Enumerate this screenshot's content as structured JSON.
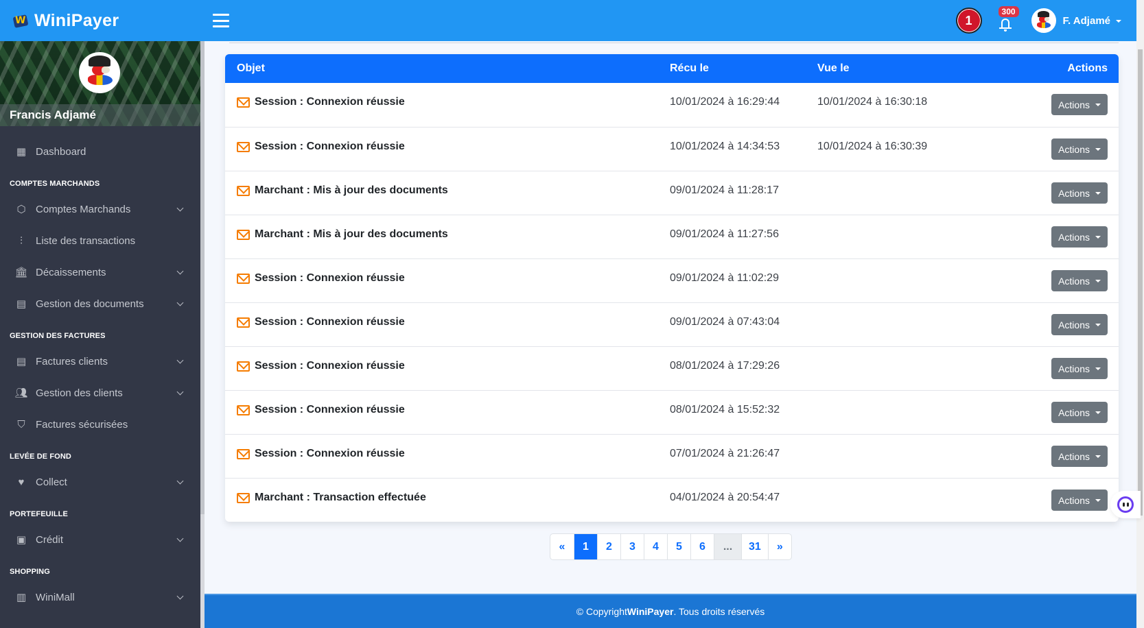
{
  "app": {
    "name": "WiniPayer"
  },
  "topbar": {
    "circle_badge": "1",
    "notifications_count": "300",
    "user_short_name": "F. Adjamé"
  },
  "sidebar": {
    "profile_name": "Francis Adjamé",
    "sections": [
      {
        "title": "",
        "items": [
          {
            "label": "Dashboard",
            "icon": "dashboard-icon",
            "has_chevron": false
          }
        ]
      },
      {
        "title": "COMPTES MARCHANDS",
        "items": [
          {
            "label": "Comptes Marchands",
            "icon": "box-icon",
            "has_chevron": true
          },
          {
            "label": "Liste des transactions",
            "icon": "sliders-icon",
            "has_chevron": false
          },
          {
            "label": "Décaissements",
            "icon": "bank-icon",
            "has_chevron": true
          },
          {
            "label": "Gestion des documents",
            "icon": "document-icon",
            "has_chevron": true
          }
        ]
      },
      {
        "title": "GESTION DES FACTURES",
        "items": [
          {
            "label": "Factures clients",
            "icon": "invoice-icon",
            "has_chevron": true
          },
          {
            "label": "Gestion des clients",
            "icon": "users-icon",
            "has_chevron": true
          },
          {
            "label": "Factures sécurisées",
            "icon": "shield-lock-icon",
            "has_chevron": false
          }
        ]
      },
      {
        "title": "LEVÉE DE FOND",
        "items": [
          {
            "label": "Collect",
            "icon": "heart-pulse-icon",
            "has_chevron": true
          }
        ]
      },
      {
        "title": "PORTEFEUILLE",
        "items": [
          {
            "label": "Crédit",
            "icon": "wallet-icon",
            "has_chevron": true
          }
        ]
      },
      {
        "title": "SHOPPING",
        "items": [
          {
            "label": "WiniMall",
            "icon": "store-icon",
            "has_chevron": true
          }
        ]
      }
    ]
  },
  "table": {
    "headers": {
      "objet": "Objet",
      "recu": "Récu le",
      "vue": "Vue le",
      "actions": "Actions"
    },
    "rows": [
      {
        "objet": "Session : Connexion réussie",
        "recu": "10/01/2024 à 16:29:44",
        "vue": "10/01/2024 à 16:30:18",
        "action": "Actions"
      },
      {
        "objet": "Session : Connexion réussie",
        "recu": "10/01/2024 à 14:34:53",
        "vue": "10/01/2024 à 16:30:39",
        "action": "Actions"
      },
      {
        "objet": "Marchant : Mis à jour des documents",
        "recu": "09/01/2024 à 11:28:17",
        "vue": "",
        "action": "Actions"
      },
      {
        "objet": "Marchant : Mis à jour des documents",
        "recu": "09/01/2024 à 11:27:56",
        "vue": "",
        "action": "Actions"
      },
      {
        "objet": "Session : Connexion réussie",
        "recu": "09/01/2024 à 11:02:29",
        "vue": "",
        "action": "Actions"
      },
      {
        "objet": "Session : Connexion réussie",
        "recu": "09/01/2024 à 07:43:04",
        "vue": "",
        "action": "Actions"
      },
      {
        "objet": "Session : Connexion réussie",
        "recu": "08/01/2024 à 17:29:26",
        "vue": "",
        "action": "Actions"
      },
      {
        "objet": "Session : Connexion réussie",
        "recu": "08/01/2024 à 15:52:32",
        "vue": "",
        "action": "Actions"
      },
      {
        "objet": "Session : Connexion réussie",
        "recu": "07/01/2024 à 21:26:47",
        "vue": "",
        "action": "Actions"
      },
      {
        "objet": "Marchant : Transaction effectuée",
        "recu": "04/01/2024 à 20:54:47",
        "vue": "",
        "action": "Actions"
      }
    ]
  },
  "pagination": {
    "prev": "«",
    "pages": [
      "1",
      "2",
      "3",
      "4",
      "5",
      "6",
      "...",
      "31"
    ],
    "current": "1",
    "next": "»"
  },
  "footer": {
    "prefix": "© Copyright ",
    "brand": "WiniPayer",
    "suffix": ". Tous droits réservés"
  },
  "colors": {
    "topbar": "#2196f3",
    "table_header": "#0d6efd",
    "sidebar": "#323746",
    "mail_icon": "#f57c00",
    "actions_button": "#6c757d",
    "footer": "#1b76d4"
  }
}
